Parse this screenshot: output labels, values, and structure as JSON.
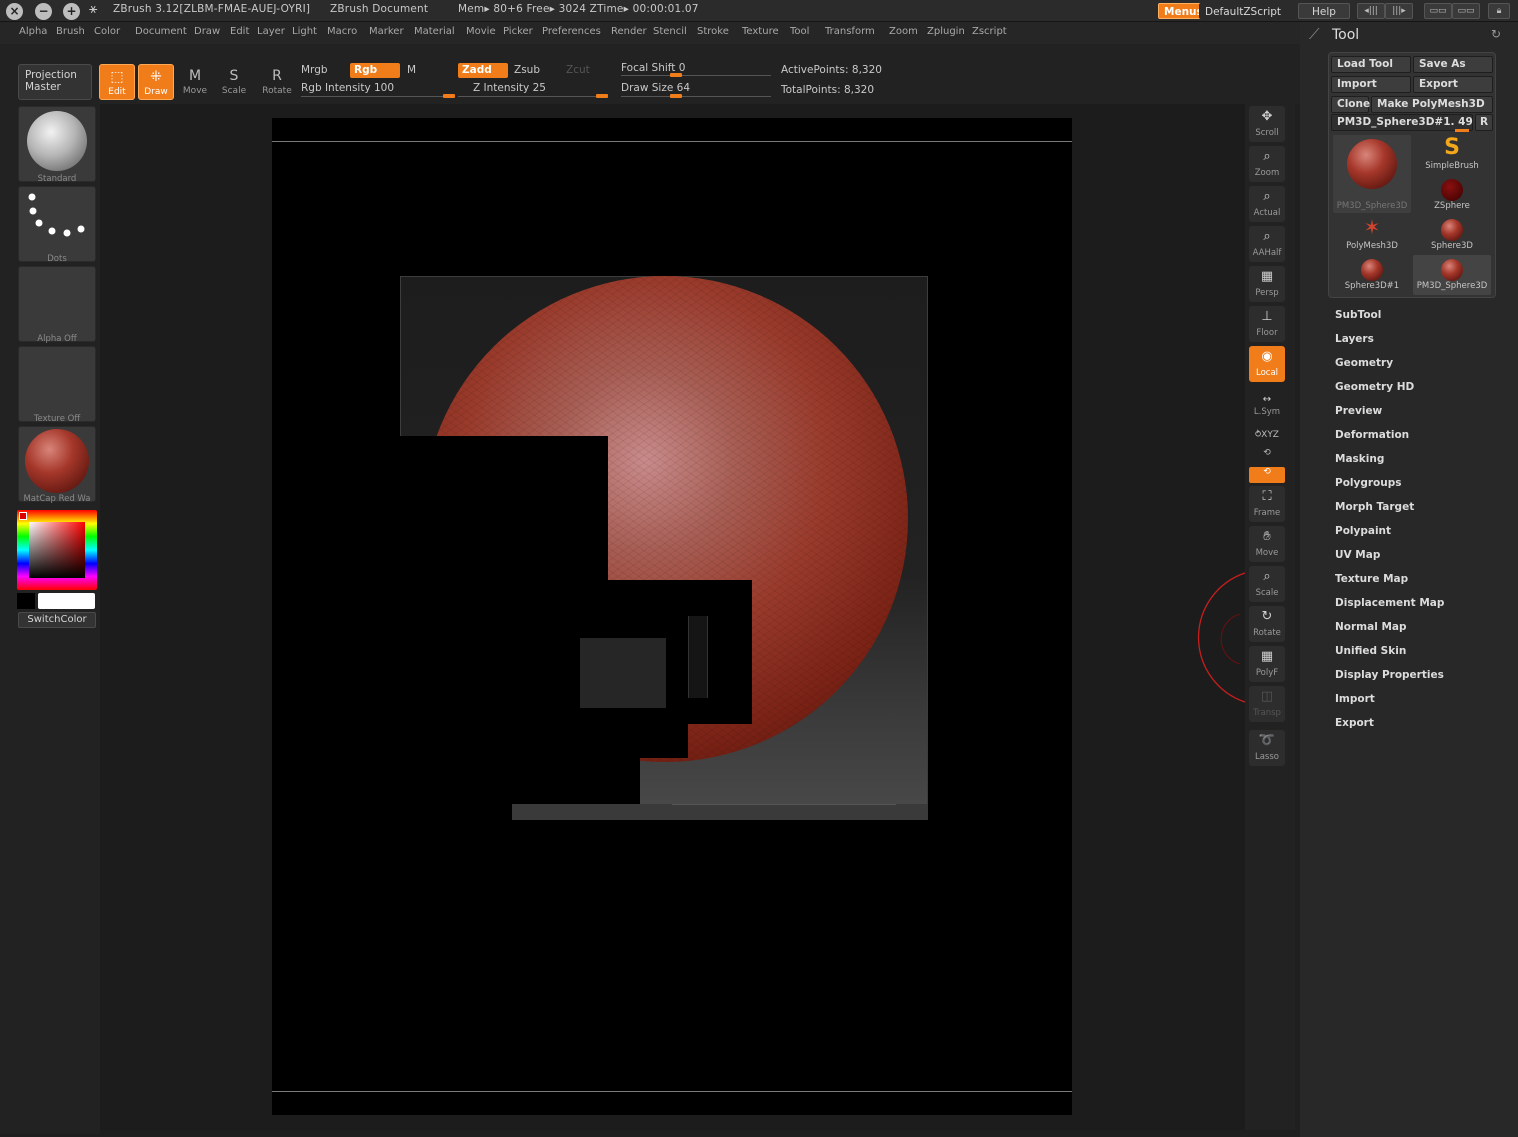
{
  "titlebar": {
    "app_title": "ZBrush 3.12[ZLBM-FMAE-AUEJ-OYRI]",
    "doc_title": "ZBrush Document",
    "mem_status": "Mem▸ 80+6  Free▸ 3024  ZTime▸ 00:00:01.07",
    "menus_label": "Menus",
    "script_label": "DefaultZScript",
    "help_label": "Help"
  },
  "menubar": {
    "items": [
      "Alpha",
      "Brush",
      "Color",
      "Document",
      "Draw",
      "Edit",
      "Layer",
      "Light",
      "Macro",
      "Marker",
      "Material",
      "Movie",
      "Picker",
      "Preferences",
      "Render",
      "Stencil",
      "Stroke",
      "Texture",
      "Tool",
      "Transform",
      "Zoom",
      "Zplugin",
      "Zscript"
    ]
  },
  "shelf": {
    "projection_master": "Projection\nMaster",
    "edit": "Edit",
    "draw": "Draw",
    "move": "Move",
    "scale": "Scale",
    "rotate": "Rotate",
    "mrgb": "Mrgb",
    "rgb": "Rgb",
    "m": "M",
    "rgb_intensity": "Rgb  Intensity 100",
    "zadd": "Zadd",
    "zsub": "Zsub",
    "zcut": "Zcut",
    "z_intensity": "Z  Intensity 25",
    "focal_shift": "Focal  Shift 0",
    "draw_size": "Draw  Size 64",
    "active_points": "ActivePoints: 8,320",
    "total_points": "TotalPoints: 8,320",
    "rgb_intensity_value": 100,
    "z_intensity_value": 25,
    "focal_shift_value": 0,
    "draw_size_value": 64
  },
  "left_tray": {
    "brush_label": "Standard",
    "stroke_label": "Dots",
    "alpha_label": "Alpha  Off",
    "texture_label": "Texture  Off",
    "material_label": "MatCap  Red  Wa",
    "switch_color": "SwitchColor"
  },
  "right_tray": {
    "scroll": "Scroll",
    "zoom": "Zoom",
    "actual": "Actual",
    "aahalf": "AAHalf",
    "persp": "Persp",
    "floor": "Floor",
    "local": "Local",
    "lsym": "L.Sym",
    "xyz": "⥁XYZ",
    "frame": "Frame",
    "move": "Move",
    "scale": "Scale",
    "rotate": "Rotate",
    "polyf": "PolyF",
    "transp": "Transp",
    "lasso": "Lasso"
  },
  "tool_palette": {
    "title": "Tool",
    "load_tool": "Load  Tool",
    "save_as": "Save  As",
    "import": "Import",
    "export": "Export",
    "clone": "Clone",
    "make_polymesh": "Make  PolyMesh3D",
    "current_tool": "PM3D_Sphere3D#1. 49",
    "r_button": "R",
    "thumbnails": {
      "pm3d_sphere": "PM3D_Sphere3D",
      "simplebrush": "SimpleBrush",
      "zsphere": "ZSphere",
      "polymesh": "PolyMesh3D",
      "sphere3d": "Sphere3D",
      "sphere3d1": "Sphere3D#1",
      "pm3d_sphere2": "PM3D_Sphere3D"
    },
    "subpalettes": [
      "SubTool",
      "Layers",
      "Geometry",
      "Geometry HD",
      "Preview",
      "Deformation",
      "Masking",
      "Polygroups",
      "Morph Target",
      "Polypaint",
      "UV Map",
      "Texture Map",
      "Displacement Map",
      "Normal Map",
      "Unified Skin",
      "Display Properties",
      "Import",
      "Export"
    ]
  },
  "colors": {
    "accent": "#f07c1a",
    "sphere": "#a5372a"
  }
}
